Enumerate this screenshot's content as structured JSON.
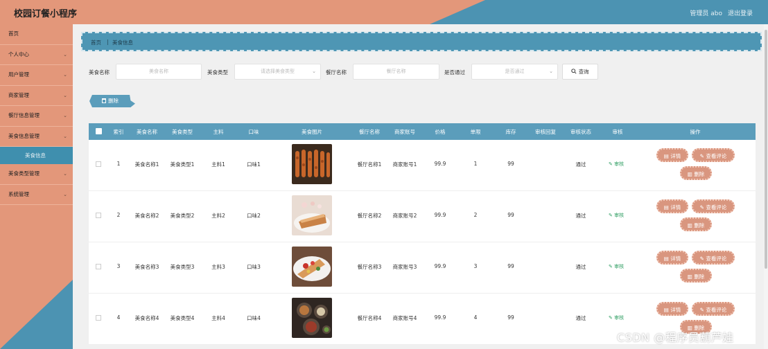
{
  "header": {
    "title": "校园订餐小程序",
    "user": "管理员 abo",
    "logout": "退出登录"
  },
  "sidebar": {
    "items": [
      {
        "label": "首页",
        "chevron": ""
      },
      {
        "label": "个人中心",
        "chevron": "⌄"
      },
      {
        "label": "用户管理",
        "chevron": "⌄"
      },
      {
        "label": "商家管理",
        "chevron": "⌄"
      },
      {
        "label": "餐厅信息管理",
        "chevron": "⌄"
      },
      {
        "label": "美食信息管理",
        "chevron": "⌄"
      }
    ],
    "active_sub": "美食信息",
    "items_after": [
      {
        "label": "美食类型管理",
        "chevron": "⌄"
      },
      {
        "label": "系统管理",
        "chevron": "⌄"
      }
    ]
  },
  "breadcrumb": {
    "home": "首页",
    "sep": "|",
    "current": "美食信息"
  },
  "filters": {
    "food_name_label": "美食名称",
    "food_name_placeholder": "美食名称",
    "food_type_label": "美食类型",
    "food_type_placeholder": "请选择美食类型",
    "restaurant_label": "餐厅名称",
    "restaurant_placeholder": "餐厅名称",
    "approved_label": "是否通过",
    "approved_placeholder": "是否通过",
    "search_label": "查询",
    "select_arrow": "⌄"
  },
  "toolbar": {
    "delete_label": "删除"
  },
  "table": {
    "headers": [
      "索引",
      "美食名称",
      "美食类型",
      "主料",
      "口味",
      "美食图片",
      "餐厅名称",
      "商家账号",
      "价格",
      "单限",
      "库存",
      "审核回复",
      "审核状态",
      "审核",
      "操作"
    ],
    "rows": [
      {
        "index": "1",
        "name": "美食名称1",
        "type": "美食类型1",
        "main": "主料1",
        "taste": "口味1",
        "restaurant": "餐厅名称1",
        "merchant": "商家账号1",
        "price": "99.9",
        "limit": "1",
        "stock": "99",
        "reply": "",
        "status": "通过",
        "audit": "审核"
      },
      {
        "index": "2",
        "name": "美食名称2",
        "type": "美食类型2",
        "main": "主料2",
        "taste": "口味2",
        "restaurant": "餐厅名称2",
        "merchant": "商家账号2",
        "price": "99.9",
        "limit": "2",
        "stock": "99",
        "reply": "",
        "status": "通过",
        "audit": "审核"
      },
      {
        "index": "3",
        "name": "美食名称3",
        "type": "美食类型3",
        "main": "主料3",
        "taste": "口味3",
        "restaurant": "餐厅名称3",
        "merchant": "商家账号3",
        "price": "99.9",
        "limit": "3",
        "stock": "99",
        "reply": "",
        "status": "通过",
        "audit": "审核"
      },
      {
        "index": "4",
        "name": "美食名称4",
        "type": "美食类型4",
        "main": "主料4",
        "taste": "口味4",
        "restaurant": "餐厅名称4",
        "merchant": "商家账号4",
        "price": "99.9",
        "limit": "4",
        "stock": "99",
        "reply": "",
        "status": "通过",
        "audit": "审核"
      }
    ],
    "actions": {
      "detail": "详情",
      "review": "查看评论",
      "delete": "删除"
    }
  },
  "watermark": "CSDN @程序员葫芦娃",
  "colors": {
    "accent_orange": "#e3977a",
    "accent_blue": "#4e96b4",
    "action_btn": "#d9967f",
    "audit_green": "#2e9e62"
  }
}
